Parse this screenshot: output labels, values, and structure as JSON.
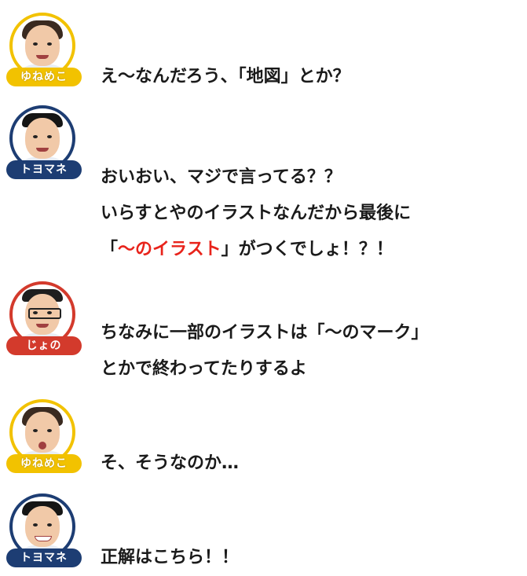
{
  "messages": [
    {
      "speaker": "ゆねめこ",
      "lines": [
        "え～なんだろう、「地図」とか？"
      ]
    },
    {
      "speaker": "トヨマネ",
      "lines": [
        "おいおい、マジで言ってる？？",
        "いらすとやのイラストなんだから最後に"
      ],
      "line3": {
        "open": "「",
        "highlight": "～のイラスト",
        "close": "」がつくでしょ！？！"
      }
    },
    {
      "speaker": "じょの",
      "lines": [
        "ちなみに一部のイラストは「～のマーク」",
        "とかで終わってたりするよ"
      ]
    },
    {
      "speaker": "ゆねめこ",
      "lines": [
        "そ、そうなのか…"
      ]
    },
    {
      "speaker": "トヨマネ",
      "lines": [
        "正解はこちら！！"
      ]
    }
  ],
  "colors": {
    "yellow": "#f2c200",
    "navy": "#1d3d73",
    "red": "#d33a2c",
    "highlight": "#e8231b"
  }
}
